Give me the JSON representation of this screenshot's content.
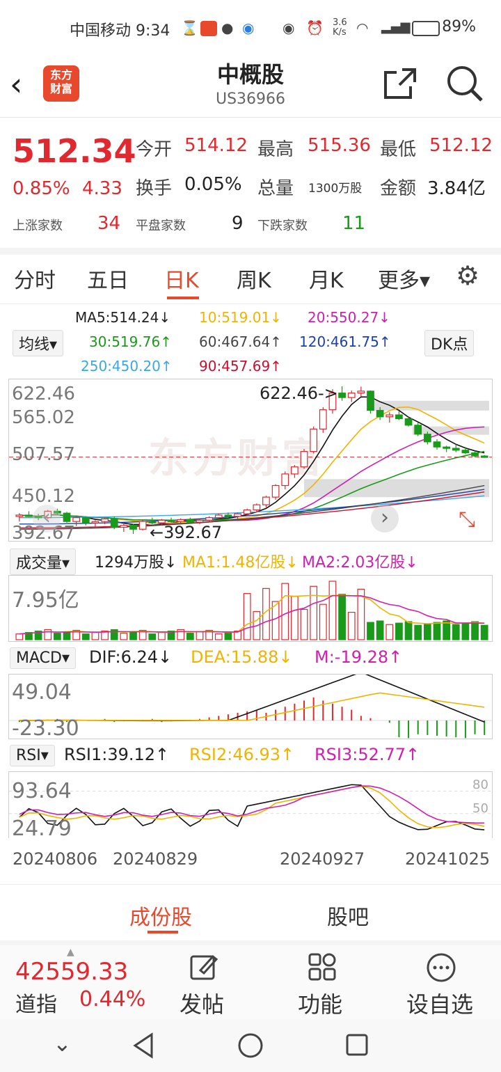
{
  "status_bar": {
    "carrier_time": "中国移动 9:34",
    "speed": "3.6\nK/s",
    "battery": "89%"
  },
  "header": {
    "logo_text": "东方\n财富",
    "title": "中概股",
    "code": "US36966"
  },
  "quote": {
    "price": "512.34",
    "pct": "0.85%",
    "chg": "4.33",
    "open_label": "今开",
    "open": "514.12",
    "high_label": "最高",
    "high": "515.36",
    "low_label": "最低",
    "low": "512.12",
    "turnover_label": "换手",
    "turnover": "0.05%",
    "volume_label": "总量",
    "volume": "1300万股",
    "amount_label": "金额",
    "amount": "3.84亿",
    "up_label": "上涨家数",
    "up": "34",
    "flat_label": "平盘家数",
    "flat": "9",
    "down_label": "下跌家数",
    "down": "11"
  },
  "tabs": {
    "t1": "分时",
    "t2": "五日",
    "t3": "日K",
    "t4": "周K",
    "t5": "月K",
    "t6": "更多▾"
  },
  "ma": {
    "btn": "均线▾",
    "dk": "DK点",
    "ma5": "MA5:514.24↓",
    "ma10": "10:519.01↓",
    "ma20": "20:550.27↓",
    "ma30": "30:519.76↑",
    "ma60": "60:467.64↑",
    "ma120": "120:461.75↑",
    "ma250": "250:450.20↑",
    "ma90": "90:457.69↑"
  },
  "kline": {
    "y_top": "622.46",
    "y_2": "565.02",
    "y_3": "507.57",
    "y_4": "450.12",
    "y_bot": "392.67",
    "max_label": "622.46->",
    "min_label": "←392.67",
    "watermark": "东方财富"
  },
  "volume": {
    "btn": "成交量▾",
    "value": "1294万股↓",
    "ma1": "MA1:1.48亿股↓",
    "ma2": "MA2:2.03亿股↓",
    "axis": "7.95亿"
  },
  "macd": {
    "btn": "MACD▾",
    "dif": "DIF:6.24↓",
    "dea": "DEA:15.88↓",
    "m": "M:-19.28↑",
    "axis_top": "49.04",
    "axis_bot": "-23.30"
  },
  "rsi": {
    "btn": "RSI▾",
    "rsi1": "RSI1:39.12↑",
    "rsi2": "RSI2:46.93↑",
    "rsi3": "RSI3:52.77↑",
    "axis_top": "93.64",
    "axis_bot": "24.79",
    "line80": "80",
    "line50": "50"
  },
  "dates": {
    "d1": "20240806",
    "d2": "20240829",
    "d3": "20240927",
    "d4": "20241025"
  },
  "subtabs": {
    "a": "成份股",
    "b": "股吧"
  },
  "bottom": {
    "index_value": "42559.33",
    "index_name": "道指",
    "index_pct": "0.44%",
    "post": "发帖",
    "func": "功能",
    "fav": "设自选"
  },
  "chart_data": {
    "type": "candlestick",
    "candles_ohlc": [
      [
        420,
        425,
        412,
        422
      ],
      [
        422,
        428,
        419,
        420
      ],
      [
        420,
        424,
        414,
        418
      ],
      [
        418,
        430,
        416,
        428
      ],
      [
        428,
        432,
        422,
        425
      ],
      [
        425,
        427,
        410,
        412
      ],
      [
        412,
        420,
        405,
        418
      ],
      [
        418,
        420,
        406,
        410
      ],
      [
        410,
        414,
        404,
        412
      ],
      [
        412,
        418,
        408,
        416
      ],
      [
        416,
        420,
        400,
        403
      ],
      [
        403,
        410,
        396,
        406
      ],
      [
        406,
        408,
        392.67,
        400
      ],
      [
        400,
        415,
        398,
        412
      ],
      [
        412,
        418,
        408,
        410
      ],
      [
        410,
        416,
        406,
        414
      ],
      [
        414,
        418,
        410,
        412
      ],
      [
        412,
        417,
        409,
        415
      ],
      [
        415,
        418,
        410,
        411
      ],
      [
        411,
        416,
        408,
        414
      ],
      [
        414,
        420,
        412,
        418
      ],
      [
        418,
        424,
        416,
        422
      ],
      [
        422,
        426,
        418,
        420
      ],
      [
        420,
        426,
        416,
        424
      ],
      [
        424,
        432,
        420,
        430
      ],
      [
        430,
        440,
        426,
        438
      ],
      [
        438,
        452,
        434,
        450
      ],
      [
        450,
        470,
        446,
        468
      ],
      [
        468,
        490,
        462,
        486
      ],
      [
        486,
        500,
        480,
        497
      ],
      [
        497,
        525,
        494,
        521
      ],
      [
        521,
        560,
        518,
        556
      ],
      [
        556,
        590,
        550,
        586
      ],
      [
        586,
        618,
        580,
        612
      ],
      [
        612,
        622.46,
        600,
        605
      ],
      [
        605,
        616,
        598,
        612
      ],
      [
        612,
        622,
        606,
        615
      ],
      [
        615,
        616,
        580,
        585
      ],
      [
        585,
        590,
        570,
        575
      ],
      [
        575,
        582,
        566,
        578
      ],
      [
        578,
        584,
        570,
        572
      ],
      [
        572,
        576,
        560,
        562
      ],
      [
        562,
        566,
        545,
        548
      ],
      [
        548,
        552,
        532,
        536
      ],
      [
        536,
        540,
        524,
        528
      ],
      [
        528,
        530,
        520,
        526
      ],
      [
        526,
        532,
        520,
        523
      ],
      [
        523,
        528,
        517,
        519
      ],
      [
        519,
        522,
        512,
        514
      ],
      [
        514,
        515.36,
        512.12,
        512.34
      ]
    ],
    "ylim": [
      392.67,
      622.46
    ]
  }
}
